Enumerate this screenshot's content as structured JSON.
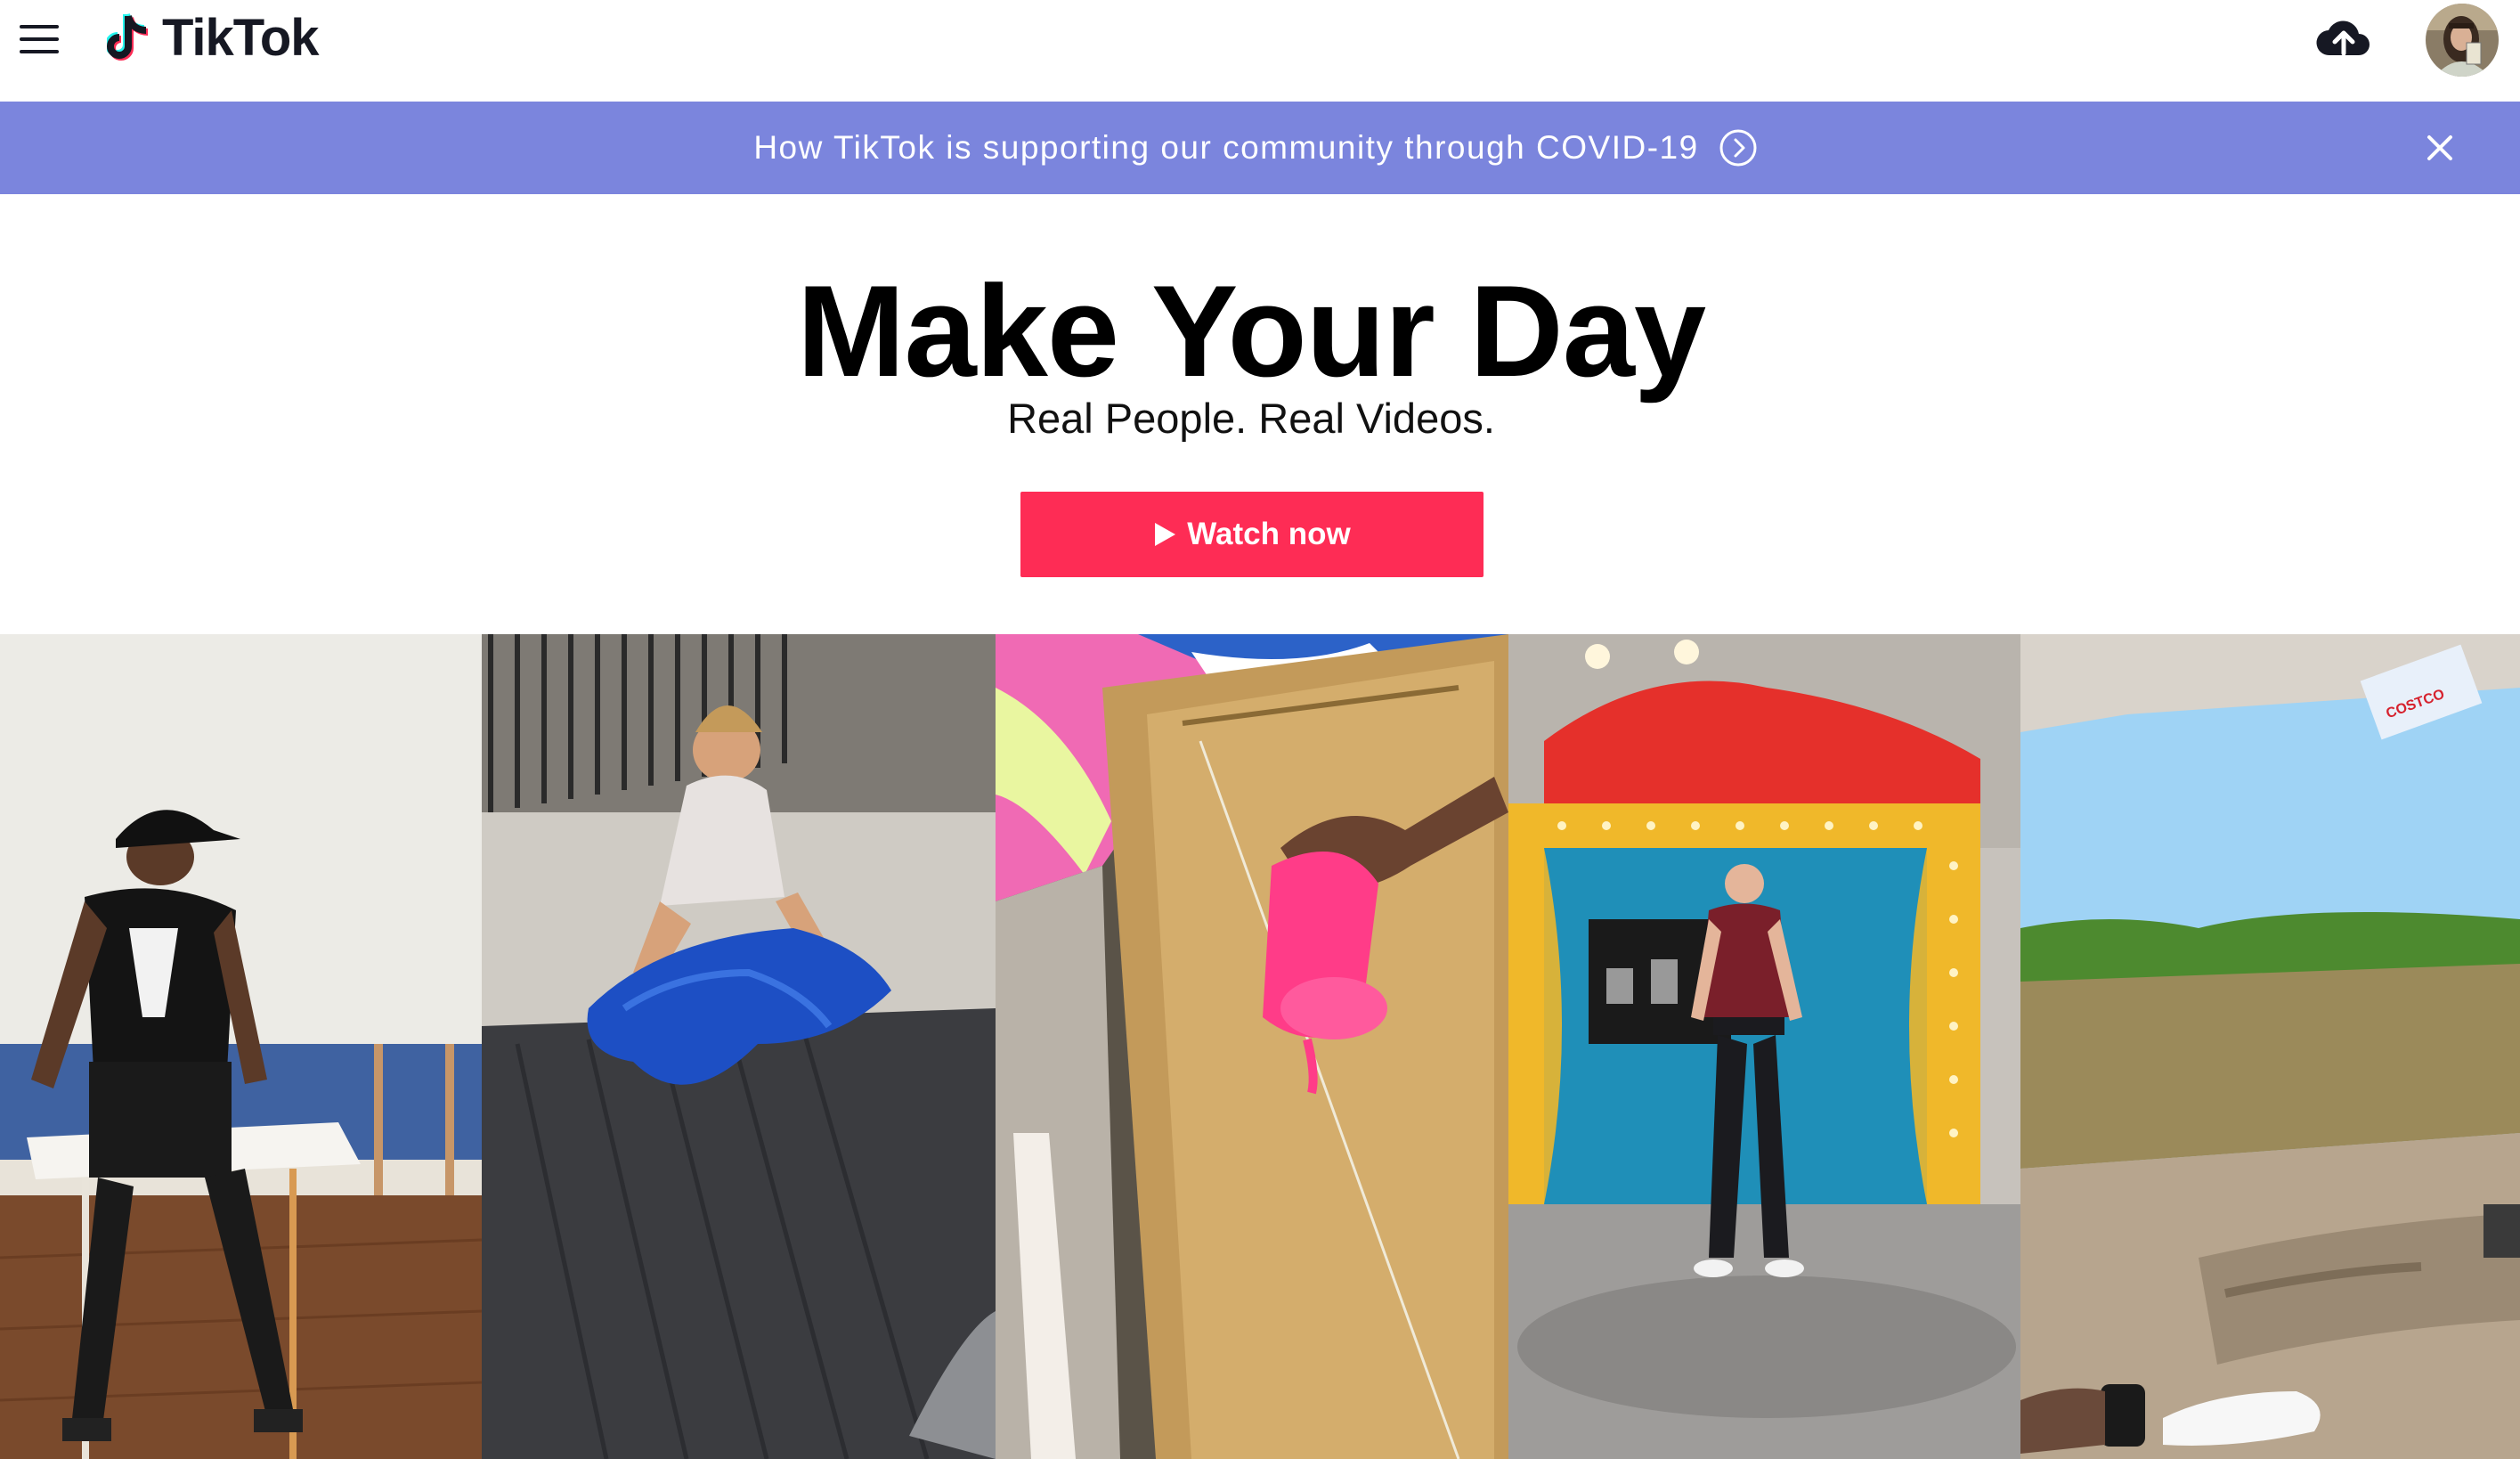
{
  "header": {
    "menu_icon": "hamburger-menu-icon",
    "brand": "TikTok",
    "logo_icon": "tiktok-note-icon",
    "upload_icon": "cloud-upload-icon",
    "avatar_icon": "user-avatar"
  },
  "banner": {
    "text": "How TikTok is supporting our community through COVID-19",
    "arrow_icon": "chevron-right-circle-icon",
    "close_icon": "close-icon",
    "color": "#7b85dd"
  },
  "hero": {
    "title": "Make Your Day",
    "subtitle": "Real People. Real Videos.",
    "cta_label": "Watch now",
    "cta_icon": "play-icon",
    "cta_color": "#fe2c55"
  },
  "videos": [
    {
      "thumbnail": "man-at-white-table"
    },
    {
      "thumbnail": "woman-with-blue-tarp-in-truck-bed"
    },
    {
      "thumbnail": "pink-paint-pour"
    },
    {
      "thumbnail": "man-on-stage-set"
    },
    {
      "thumbnail": "car-window-field-view"
    }
  ]
}
